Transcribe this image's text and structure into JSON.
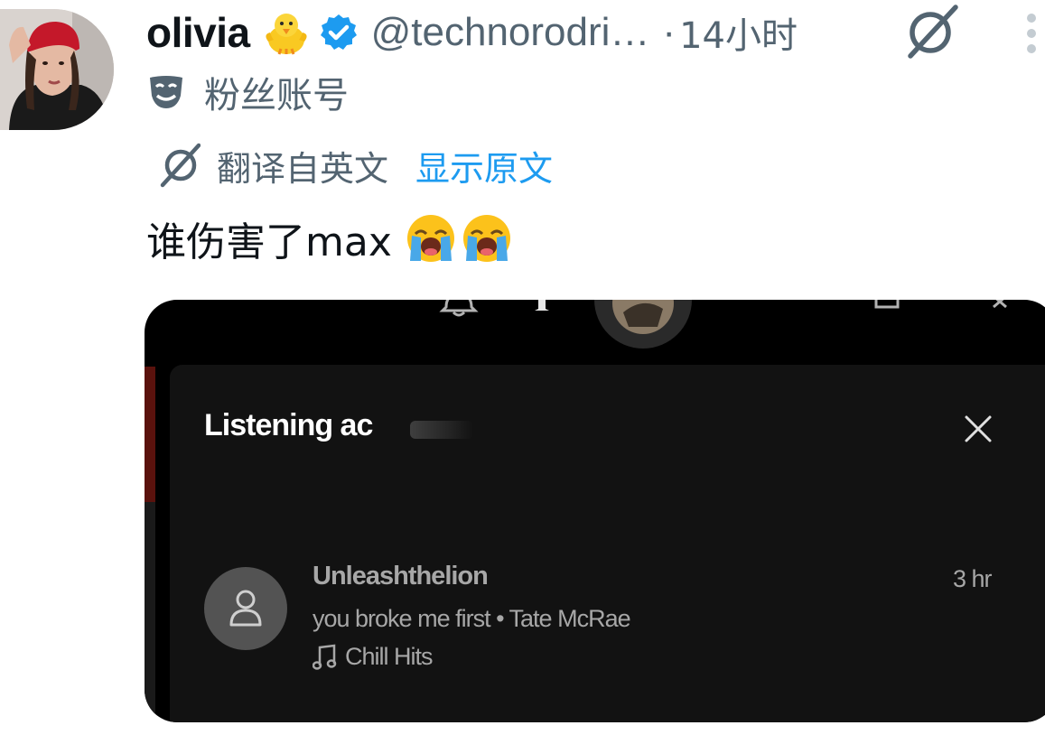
{
  "tweet": {
    "author_name": "olivia",
    "author_handle": "@technorodri…",
    "separator": "·",
    "time": "14小时",
    "account_label": "粉丝账号",
    "translated_from": "翻译自英文",
    "show_original": "显示原文",
    "text": "谁伤害了max"
  },
  "icons": {
    "chick": "baby-chick-emoji",
    "verified": "verified-badge-icon",
    "grok": "grok-icon",
    "more": "more-vertical-icon",
    "mask": "theater-mask-icon",
    "translate": "grok-translate-icon",
    "crying": "loudly-crying-face-emoji"
  },
  "media": {
    "panel_title": "Listening ac",
    "friend": {
      "name": "Unleashthelion",
      "track": "you broke me first • Tate McRae",
      "playlist": "Chill Hits",
      "time_ago": "3 hr"
    }
  },
  "colors": {
    "name_text": "#0f1419",
    "secondary_text": "#536471",
    "link_blue": "#1d9bf0",
    "verified_blue": "#1d9bf0",
    "spotify_panel": "#121212",
    "spotify_text": "#a7a7a7"
  }
}
